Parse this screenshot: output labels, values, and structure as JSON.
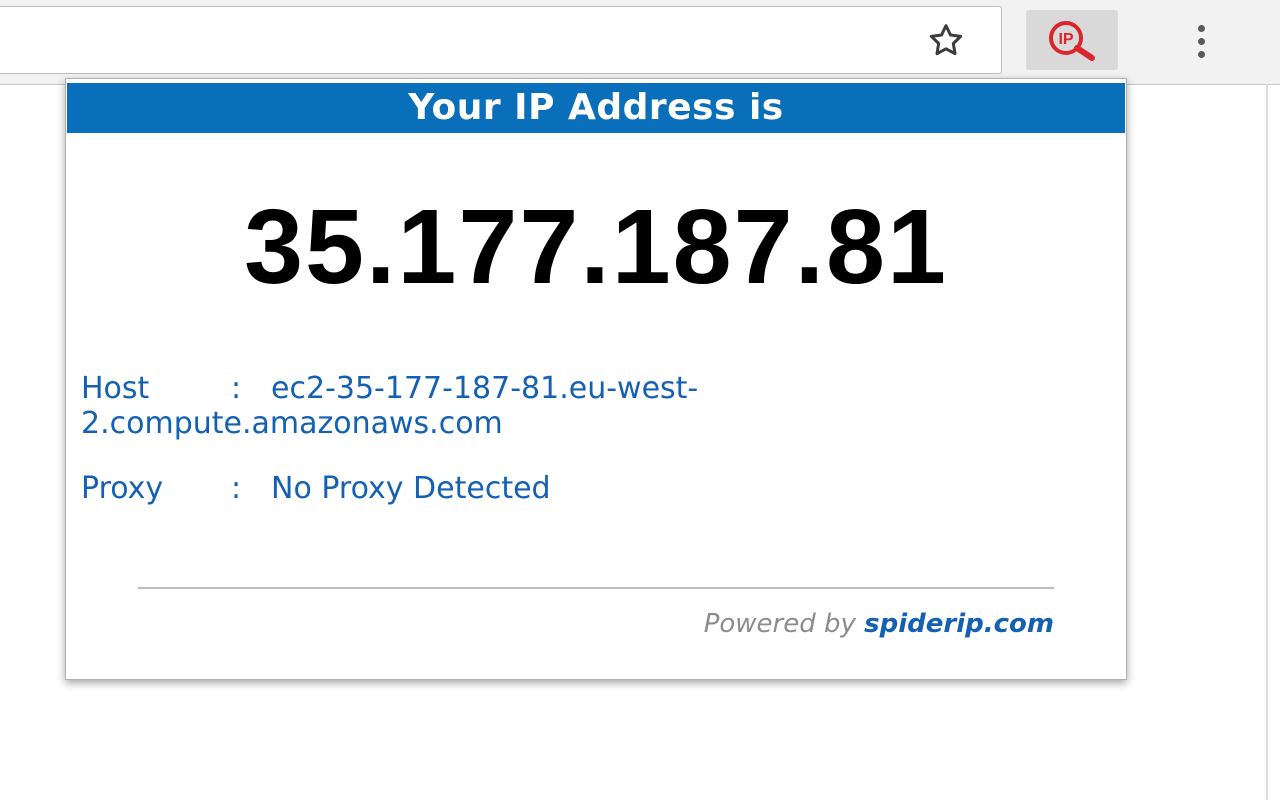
{
  "browser": {
    "bookmark_icon": "star-icon",
    "extension_icon": "ip-magnifier-icon",
    "menu_icon": "kebab-menu-icon"
  },
  "popup": {
    "header_title": "Your IP Address is",
    "ip_address": "35.177.187.81",
    "host_label": "Host",
    "host_separator": ":",
    "host_value": "ec2-35-177-187-81.eu-west-2.compute.amazonaws.com",
    "proxy_label": "Proxy",
    "proxy_separator": ":",
    "proxy_value": "No Proxy Detected",
    "powered_by_prefix": "Powered by",
    "powered_by_brand": "spiderip.com"
  },
  "colors": {
    "header_bg": "#0a6fba",
    "info_text": "#1461b4",
    "extension_icon": "#d9262c"
  }
}
